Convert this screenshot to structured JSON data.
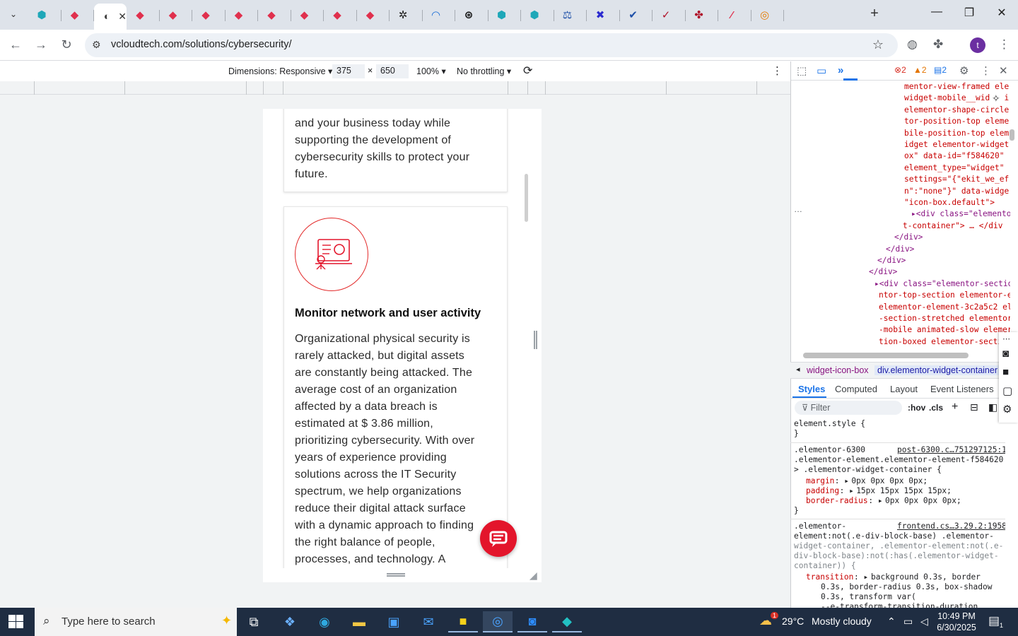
{
  "browser": {
    "tabs": [
      {
        "icon": "chromium-icon",
        "glyph": "⬢",
        "color": "#1ea7b8"
      },
      {
        "icon": "gem-icon",
        "glyph": "◆",
        "color": "#e0304d"
      },
      {
        "icon": "page-icon",
        "glyph": "◐",
        "color": "#444444",
        "active": true
      },
      {
        "icon": "gem-icon",
        "glyph": "◆",
        "color": "#e0304d"
      },
      {
        "icon": "gem-icon",
        "glyph": "◆",
        "color": "#e0304d"
      },
      {
        "icon": "gem-icon",
        "glyph": "◆",
        "color": "#e0304d"
      },
      {
        "icon": "gem-icon",
        "glyph": "◆",
        "color": "#e0304d"
      },
      {
        "icon": "gem-icon",
        "glyph": "◆",
        "color": "#e0304d"
      },
      {
        "icon": "gem-icon",
        "glyph": "◆",
        "color": "#e0304d"
      },
      {
        "icon": "gem-icon",
        "glyph": "◆",
        "color": "#e0304d"
      },
      {
        "icon": "gem-icon",
        "glyph": "◆",
        "color": "#e0304d"
      },
      {
        "icon": "gear-icon",
        "glyph": "✲",
        "color": "#222222"
      },
      {
        "icon": "rainbow-icon",
        "glyph": "◠",
        "color": "#1d6fd6"
      },
      {
        "icon": "openai-icon",
        "glyph": "⊛",
        "color": "#111111"
      },
      {
        "icon": "chromium-icon",
        "glyph": "⬢",
        "color": "#1ea7b8"
      },
      {
        "icon": "chromium-icon",
        "glyph": "⬢",
        "color": "#1ea7b8"
      },
      {
        "icon": "scales-icon",
        "glyph": "⚖",
        "color": "#1d4fa8"
      },
      {
        "icon": "x-icon",
        "glyph": "✖",
        "color": "#2b2bd0"
      },
      {
        "icon": "check-icon",
        "glyph": "✔",
        "color": "#1d4fa8"
      },
      {
        "icon": "check-icon",
        "glyph": "✓",
        "color": "#b0142a"
      },
      {
        "icon": "puzzle-icon",
        "glyph": "✤",
        "color": "#b0142a"
      },
      {
        "icon": "swoosh-icon",
        "glyph": "⁄",
        "color": "#e0304d"
      },
      {
        "icon": "ring-icon",
        "glyph": "◎",
        "color": "#e67a00"
      }
    ],
    "url": "vcloudtech.com/solutions/cybersecurity/",
    "profile_initial": "t"
  },
  "device_toolbar": {
    "dimensions_label": "Dimensions: Responsive",
    "width": "375",
    "times": "×",
    "height": "650",
    "zoom": "100%",
    "throttling": "No throttling"
  },
  "page": {
    "card1_lines": [
      "and your business today while",
      "supporting the development of",
      "cybersecurity skills to protect your",
      "future."
    ],
    "card2_title": "Monitor network and user activity",
    "card2_lines": [
      "Organizational physical security is",
      "rarely attacked, but digital assets",
      "are constantly being attacked. The",
      "average cost of an organization",
      "affected by a data breach is",
      "estimated at $ 3.86 million,",
      "prioritizing cybersecurity. With over",
      "years of experience providing",
      "solutions across the IT Security",
      "spectrum, we help organizations",
      "reduce their digital attack surface",
      "with a dynamic approach to finding",
      "the right balance of people,",
      "processes, and technology. A"
    ],
    "accent": "#e3152b"
  },
  "devtools": {
    "errors": "2",
    "warnings": "2",
    "info": "2",
    "element_lines": [
      {
        "indent": 0,
        "html": "mentor-view-framed ele"
      },
      {
        "indent": 0,
        "html": "widget-mobile__wid   i"
      },
      {
        "indent": 0,
        "html": "elementor-shape-circle"
      },
      {
        "indent": 0,
        "html": "tor-position-top eleme"
      },
      {
        "indent": 0,
        "html": "bile-position-top elem"
      },
      {
        "indent": 0,
        "html": "idget elementor-widget"
      },
      {
        "indent": 0,
        "html": "ox\" data-id=\"f584620\""
      },
      {
        "indent": 0,
        "html": "element_type=\"widget\""
      },
      {
        "indent": 0,
        "html": "settings=\"{\"ekit_we_ef"
      },
      {
        "indent": 0,
        "html": "n\":\"none\"}\" data-widge"
      },
      {
        "indent": 0,
        "html": "\"icon-box.default\">"
      },
      {
        "indent": 1,
        "html": "▸<div class=\"elementor"
      },
      {
        "indent": 2,
        "html": "t-container\"> … </div"
      },
      {
        "indent": 3,
        "html": "</div>"
      },
      {
        "indent": 4,
        "html": "</div>"
      },
      {
        "indent": 5,
        "html": "</div>"
      },
      {
        "indent": 6,
        "html": "</div>"
      },
      {
        "indent": 7,
        "html": "▸<div class=\"elementor-sectio"
      },
      {
        "indent": 8,
        "html": "ntor-top-section elementor-e"
      },
      {
        "indent": 8,
        "html": "elementor-element-3c2a5c2 el"
      },
      {
        "indent": 8,
        "html": "-section-stretched elementor"
      },
      {
        "indent": 8,
        "html": "-mobile animated-slow elemer"
      },
      {
        "indent": 8,
        "html": "tion-boxed elementor-secti"
      }
    ],
    "ellipsis": "…",
    "breadcrumbs": [
      "widget-icon-box",
      "div.elementor-widget-container"
    ],
    "style_tabs": [
      "Styles",
      "Computed",
      "Layout",
      "Event Listeners"
    ],
    "filter_placeholder": "Filter",
    "hov": ":hov",
    "cls": ".cls",
    "styles": {
      "element_style_open": "element.style {",
      "close": "}",
      "rule1_selector": [
        ".elementor-6300",
        ".elementor-element.elementor-element-f584620",
        "> .elementor-widget-container {"
      ],
      "rule1_source": "post-6300.c…751297125:1",
      "rule1_props": [
        {
          "name": "margin",
          "value": "0px 0px 0px 0px;"
        },
        {
          "name": "padding",
          "value": "15px 15px 15px 15px;"
        },
        {
          "name": "border-radius",
          "value": "0px 0px 0px 0px;"
        }
      ],
      "rule2_selector": [
        ".elementor-",
        "element:not(.e-div-block-base) .elementor-",
        "widget-container, .elementor-element:not(.e-",
        "div-block-base):not(:has(.elementor-widget-",
        "container)) {"
      ],
      "rule2_source": "frontend.cs…3.29.2:1958",
      "rule2_prop": "transition",
      "rule2_value_lines": [
        "background 0.3s, border",
        "0.3s, border-radius 0.3s, box-shadow",
        "0.3s, transform var(",
        "--e-transform-transition-duration,"
      ]
    }
  },
  "taskbar": {
    "search_placeholder": "Type here to search",
    "weather_temp": "29°C",
    "weather_text": "Mostly cloudy",
    "weather_badge": "1",
    "time": "10:49 PM",
    "date": "6/30/2025",
    "notifications": "1"
  }
}
